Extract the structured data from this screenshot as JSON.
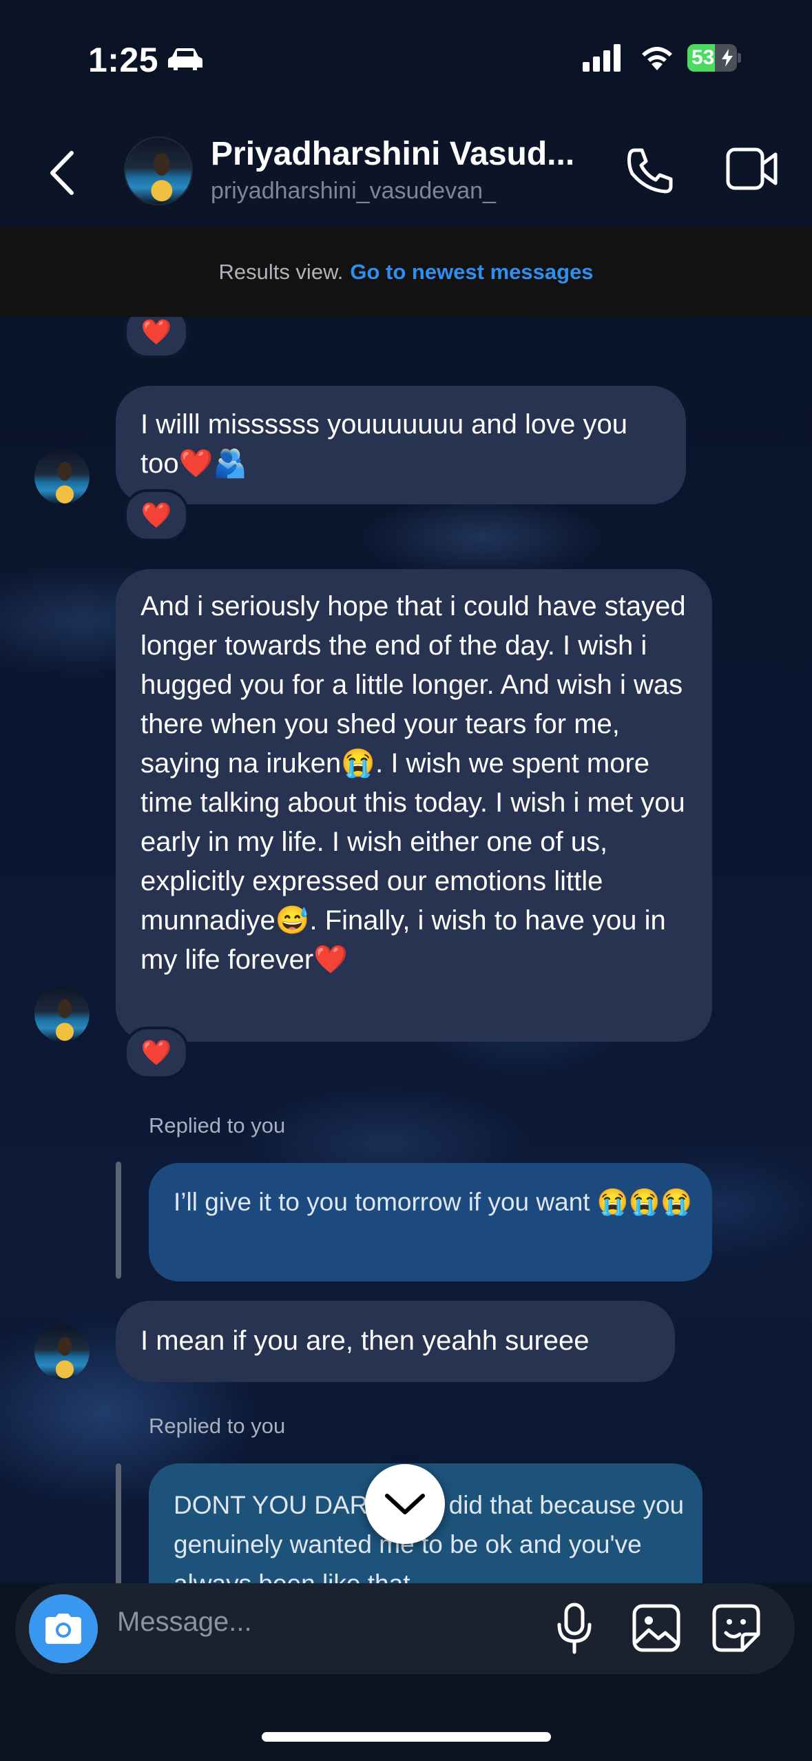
{
  "status_bar": {
    "time": "1:25",
    "battery": "53"
  },
  "header": {
    "name": "Priyadharshini Vasud...",
    "username": "priyadharshini_vasudevan_"
  },
  "banner": {
    "text": "Results view.",
    "link": "Go to newest messages"
  },
  "messages": [
    {
      "reaction": "❤️"
    },
    {
      "text": "I willl missssss youuuuuuu and love you too❤️🫂",
      "reaction": "❤️"
    },
    {
      "text": "And i seriously hope that i could have stayed longer towards the end of the day. I wish i hugged you for a little longer. And wish i was there when you shed your tears for me, saying na iruken😭. I wish we spent more time talking about this today. I wish i met you early in my life. I wish either one of us, explicitly expressed our emotions little munnadiye😅. Finally, i wish to have you in my life forever❤️",
      "reaction": "❤️"
    },
    {
      "replied_label": "Replied to you",
      "quoted": "I’ll give it to you tomorrow if you want 😭😭😭"
    },
    {
      "text": "I mean if you are, then yeahh sureee"
    },
    {
      "replied_label": "Replied to you",
      "quoted": "DONT YOU DARE. You did that because you genuinely wanted me to be ok and you've always been like that"
    }
  ],
  "composer": {
    "placeholder": "Message..."
  },
  "icons": [
    "car-icon",
    "signal-icon",
    "wifi-icon",
    "battery-icon",
    "back-icon",
    "phone-icon",
    "video-icon",
    "chevron-down-icon",
    "camera-icon",
    "microphone-icon",
    "gallery-icon",
    "sticker-icon"
  ]
}
